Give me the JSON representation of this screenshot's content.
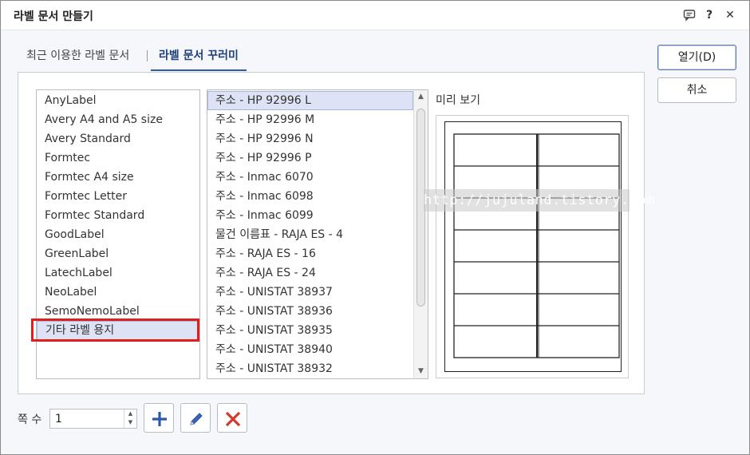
{
  "window": {
    "title": "라벨 문서 만들기",
    "icons": [
      "comment-icon",
      "help-icon",
      "close-icon"
    ],
    "help_glyph": "?",
    "close_glyph": "✕"
  },
  "tabs": [
    {
      "label": "최근 이용한 라벨 문서",
      "active": false
    },
    {
      "label": "라벨 문서 꾸러미",
      "active": true
    }
  ],
  "vendors": {
    "items": [
      "AnyLabel",
      "Avery A4 and A5 size",
      "Avery Standard",
      "Formtec",
      "Formtec A4 size",
      "Formtec Letter",
      "Formtec Standard",
      "GoodLabel",
      "GreenLabel",
      "LatechLabel",
      "NeoLabel",
      "SemoNemoLabel",
      "기타 라벨 용지"
    ],
    "selected_index": 12
  },
  "products": {
    "items": [
      "주소 - HP 92996 L",
      "주소 - HP 92996 M",
      "주소 - HP 92996 N",
      "주소 - HP 92996 P",
      "주소 - Inmac 6070",
      "주소 - Inmac 6098",
      "주소 - Inmac 6099",
      "물건 이름표 - RAJA ES - 4",
      "주소 - RAJA ES - 16",
      "주소 - RAJA ES - 24",
      "주소 - UNISTAT 38937",
      "주소 - UNISTAT 38936",
      "주소 - UNISTAT 38935",
      "주소 - UNISTAT 38940",
      "주소 - UNISTAT 38932"
    ],
    "selected_index": 0
  },
  "preview": {
    "label": "미리 보기",
    "rows": 7,
    "cols": 2
  },
  "buttons": {
    "open_label": "열기(D)",
    "cancel_label": "취소"
  },
  "pages": {
    "label": "쪽 수",
    "value": "1"
  },
  "watermark": "http://jujuland.tistory.com",
  "colors": {
    "accent": "#2d5aa5",
    "add_icon": "#2d5aa5",
    "edit_icon": "#3a66b5",
    "delete_icon": "#d33a2c",
    "highlight": "#e01e1e"
  }
}
